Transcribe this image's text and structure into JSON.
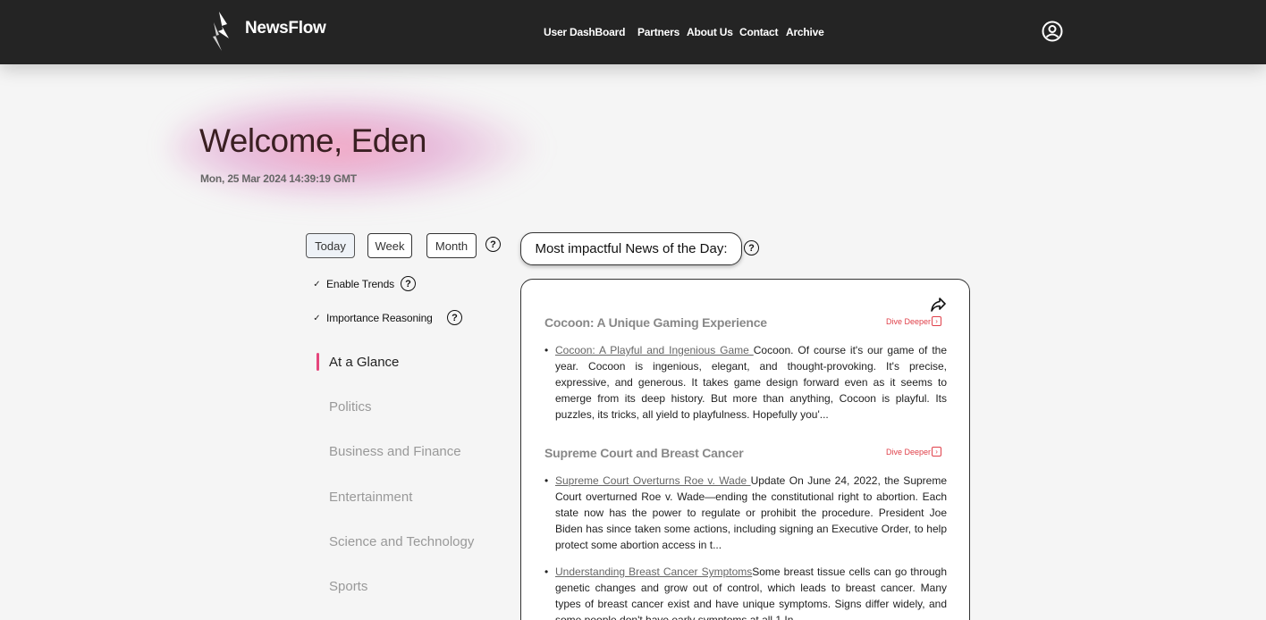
{
  "header": {
    "brand": "NewsFlow",
    "nav": [
      "User DashBoard",
      "Partners",
      "About Us",
      "Contact",
      "Archive"
    ]
  },
  "welcome": {
    "title": "Welcome, Eden",
    "datetime": "Mon, 25 Mar 2024 14:39:19 GMT"
  },
  "range": {
    "options": [
      "Today",
      "Week",
      "Month"
    ],
    "selected": "Today"
  },
  "toggles": [
    {
      "label": "Enable Trends",
      "checked": true
    },
    {
      "label": "Importance Reasoning",
      "checked": true
    }
  ],
  "categories": {
    "items": [
      "At a Glance",
      "Politics",
      "Business and Finance",
      "Entertainment",
      "Science and Technology",
      "Sports"
    ],
    "active": "At a Glance"
  },
  "impact": {
    "heading": "Most impactful News of the Day:"
  },
  "stories": [
    {
      "title": "Cocoon: A Unique Gaming Experience",
      "dive_label": "Dive Deeper",
      "items": [
        {
          "link": "Cocoon: A Playful and Ingenious Game ",
          "text": "Cocoon. Of course it's our game of the year. Cocoon is ingenious, elegant, and thought-provoking. It's precise, expressive, and generous. It takes game design forward even as it seems to emerge from its deep history. But more than anything, Cocoon is playful. Its puzzles, its tricks, all yield to playfulness. Hopefully you'..."
        }
      ]
    },
    {
      "title": "Supreme Court and Breast Cancer",
      "dive_label": "Dive Deeper",
      "items": [
        {
          "link": "Supreme Court Overturns Roe v. Wade ",
          "text": "Update On June 24, 2022, the Supreme Court overturned Roe v. Wade—ending the constitutional right to abortion. Each state now has the power to regulate or prohibit the procedure. President Joe Biden has since taken some actions, including signing an Executive Order, to help protect some abortion access in t..."
        },
        {
          "link": "Understanding Breast Cancer Symptoms",
          "text": "Some breast tissue cells can go through genetic changes and grow out of control, which leads to breast cancer. Many types of breast cancer exist and have unique symptoms. Signs differ widely, and some people don't have early symptoms at all.1 In"
        }
      ]
    }
  ],
  "colors": {
    "topbar": "#242424",
    "accent": "#e5467c",
    "dive": "#e0404a"
  }
}
